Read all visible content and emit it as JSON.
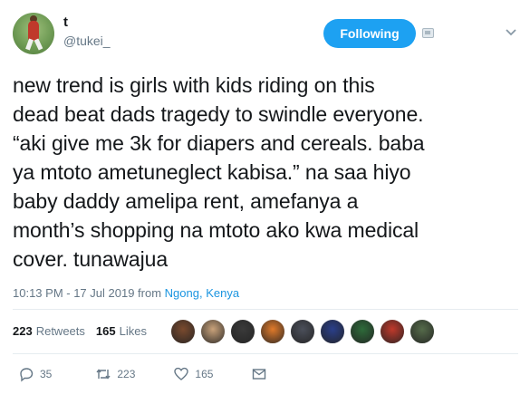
{
  "header": {
    "display_name": "t",
    "handle": "@tukei_",
    "follow_label": "Following"
  },
  "tweet": {
    "text": "new trend is girls with kids riding on this\ndead beat dads tragedy to swindle everyone.\n“aki give me 3k for diapers and cereals. baba\nya mtoto ametuneglect kabisa.” na saa hiyo\nbaby daddy amelipa rent, amefanya a\nmonth’s shopping na mtoto ako kwa medical\ncover. tunawajua",
    "timestamp": "10:13 PM - 17 Jul 2019 from",
    "location": "Ngong, Kenya"
  },
  "stats": {
    "retweets_count": "223",
    "retweets_label": "Retweets",
    "likes_count": "165",
    "likes_label": "Likes",
    "liker_avatar_colors": [
      "#7a4a2e",
      "#c9a27a",
      "#3a3a3a",
      "#e07a2a",
      "#4b4f5a",
      "#2a3f8a",
      "#2e6b3a",
      "#c0392b",
      "#556b4a"
    ]
  },
  "actions": {
    "reply_count": "35",
    "retweet_count": "223",
    "like_count": "165"
  },
  "icons": {
    "notif": "notification-settings-icon",
    "more": "chevron-down-icon",
    "reply": "reply-icon",
    "retweet": "retweet-icon",
    "like": "heart-icon",
    "dm": "envelope-icon"
  },
  "colors": {
    "accent": "#1da1f2",
    "link": "#1b95e0",
    "muted": "#657786"
  }
}
